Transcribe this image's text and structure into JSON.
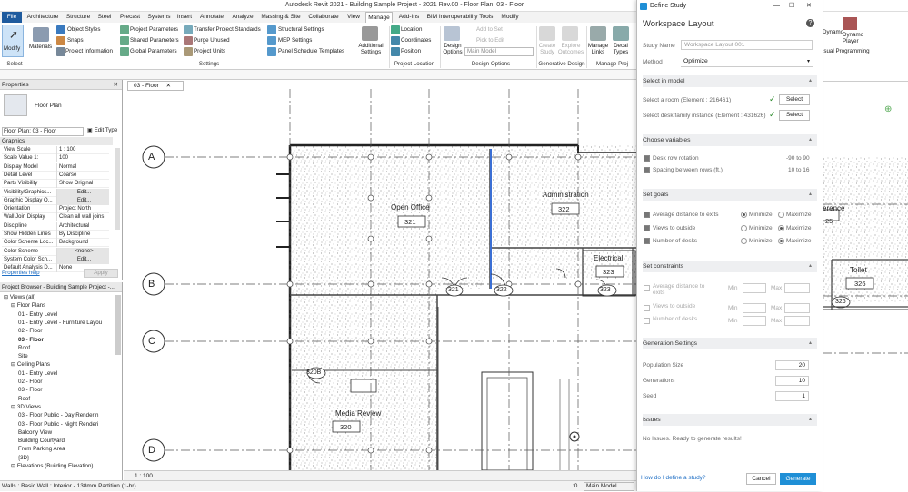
{
  "app": {
    "title": "Autodesk Revit 2021 - Building Sample Project - 2021 Rev.00 - Floor Plan: 03 - Floor"
  },
  "tabs": [
    "File",
    "Architecture",
    "Structure",
    "Steel",
    "Precast",
    "Systems",
    "Insert",
    "Annotate",
    "Analyze",
    "Massing & Site",
    "Collaborate",
    "View",
    "Manage",
    "Add-Ins",
    "BIM Interoperability Tools",
    "Modify"
  ],
  "ribbon": {
    "modify": "Modify",
    "materials": "Materials",
    "object_styles": "Object Styles",
    "snaps": "Snaps",
    "project_information": "Project Information",
    "project_parameters": "Project Parameters",
    "shared_parameters": "Shared Parameters",
    "global_parameters": "Global Parameters",
    "transfer_standards": "Transfer Project Standards",
    "purge_unused": "Purge Unused",
    "project_units": "Project Units",
    "structural_settings": "Structural Settings",
    "mep_settings": "MEP Settings",
    "panel_schedule_templates": "Panel Schedule Templates",
    "additional_settings": "Additional Settings",
    "location": "Location",
    "coordinates": "Coordinates",
    "position": "Position",
    "design_options": "Design Options",
    "add_to_set": "Add to Set",
    "pick_to_edit": "Pick to Edit",
    "main_model": "Main Model",
    "create_study": "Create Study",
    "explore_outcomes": "Explore Outcomes",
    "manage_links": "Manage Links",
    "decal_types": "Decal Types",
    "dynamo": "Dynamo",
    "dynamo_player": "Dynamo Player",
    "groups": {
      "select": "Select",
      "settings": "Settings",
      "project_location": "Project Location",
      "design_options": "Design Options",
      "generative_design": "Generative Design",
      "manage_project": "Manage Proj",
      "visual_programming": "isual Programming"
    }
  },
  "properties": {
    "title": "Properties",
    "type": "Floor Plan",
    "selector": "Floor Plan: 03 - Floor",
    "edit_type": "Edit Type",
    "section": "Graphics",
    "rows": [
      {
        "k": "View Scale",
        "v": "1 : 100"
      },
      {
        "k": "Scale Value 1:",
        "v": "100"
      },
      {
        "k": "Display Model",
        "v": "Normal"
      },
      {
        "k": "Detail Level",
        "v": "Coarse"
      },
      {
        "k": "Parts Visibility",
        "v": "Show Original"
      },
      {
        "k": "Visibility/Graphics...",
        "v": "Edit..."
      },
      {
        "k": "Graphic Display O...",
        "v": "Edit..."
      },
      {
        "k": "Orientation",
        "v": "Project North"
      },
      {
        "k": "Wall Join Display",
        "v": "Clean all wall joins"
      },
      {
        "k": "Discipline",
        "v": "Architectural"
      },
      {
        "k": "Show Hidden Lines",
        "v": "By Discipline"
      },
      {
        "k": "Color Scheme Loc...",
        "v": "Background"
      },
      {
        "k": "Color Scheme",
        "v": "<none>"
      },
      {
        "k": "System Color Sch...",
        "v": "Edit..."
      },
      {
        "k": "Default Analysis D...",
        "v": "None"
      }
    ],
    "help": "Properties help",
    "apply": "Apply"
  },
  "browser": {
    "title": "Project Browser - Building Sample Project -...",
    "items": [
      {
        "t": "Views (all)",
        "d": 0
      },
      {
        "t": "Floor Plans",
        "d": 1
      },
      {
        "t": "01 - Entry Level",
        "d": 2
      },
      {
        "t": "01 - Entry Level - Furniture Layou",
        "d": 2
      },
      {
        "t": "02 - Floor",
        "d": 2
      },
      {
        "t": "03 - Floor",
        "d": 2
      },
      {
        "t": "Roof",
        "d": 2
      },
      {
        "t": "Site",
        "d": 2
      },
      {
        "t": "Ceiling Plans",
        "d": 1
      },
      {
        "t": "01 - Entry Level",
        "d": 2
      },
      {
        "t": "02 - Floor",
        "d": 2
      },
      {
        "t": "03 - Floor",
        "d": 2
      },
      {
        "t": "Roof",
        "d": 2
      },
      {
        "t": "3D Views",
        "d": 1
      },
      {
        "t": "03 - Floor Public - Day Renderin",
        "d": 2
      },
      {
        "t": "03 - Floor Public - Night Renderi",
        "d": 2
      },
      {
        "t": "Balcony View",
        "d": 2
      },
      {
        "t": "Building Courtyard",
        "d": 2
      },
      {
        "t": "From Parking Area",
        "d": 2
      },
      {
        "t": "{3D}",
        "d": 2
      },
      {
        "t": "Elevations (Building Elevation)",
        "d": 1
      }
    ]
  },
  "view": {
    "tab": "03 - Floor",
    "grids": [
      "A",
      "B",
      "C",
      "D"
    ],
    "rooms": [
      {
        "name": "Open Office",
        "num": "321"
      },
      {
        "name": "Administration",
        "num": "322"
      },
      {
        "name": "Electrical",
        "num": "323"
      },
      {
        "name": "Media Review",
        "num": "320"
      },
      {
        "name": "Toilet",
        "num": "326"
      },
      {
        "name": "erence",
        "num": "25"
      }
    ],
    "tags": [
      "321",
      "322",
      "323",
      "320B",
      "326"
    ],
    "scale": "1 : 100"
  },
  "status": {
    "text": "Walls : Basic Wall : Interior - 138mm Partition (1-hr)",
    "model": "Main Model",
    "zero": ":0"
  },
  "dialog": {
    "window_title": "Define Study",
    "heading": "Workspace Layout",
    "study_name_label": "Study Name",
    "study_name_placeholder": "Workspace Layout 001",
    "method_label": "Method",
    "method_value": "Optimize",
    "sections": {
      "select": "Select in model",
      "variables": "Choose variables",
      "goals": "Set goals",
      "constraints": "Set constraints",
      "generation": "Generation Settings",
      "issues": "Issues"
    },
    "select_room": "Select a room (Element : 216461)",
    "select_desk": "Select desk family instance (Element : 431626)",
    "select_btn": "Select",
    "variables": [
      {
        "label": "Desk row rotation",
        "range": "-90 to 90"
      },
      {
        "label": "Spacing between rows (ft.)",
        "range": "10 to 16"
      }
    ],
    "goals": [
      {
        "label": "Average distance to exits",
        "choice": "Minimize"
      },
      {
        "label": "Views to outside",
        "choice": "Maximize"
      },
      {
        "label": "Number of desks",
        "choice": "Maximize"
      }
    ],
    "minimize": "Minimize",
    "maximize": "Maximize",
    "constraints": [
      {
        "label": "Average distance to exits"
      },
      {
        "label": "Views to outside"
      },
      {
        "label": "Number of desks"
      }
    ],
    "min": "Min",
    "max": "Max",
    "generation": [
      {
        "label": "Population Size",
        "value": "20"
      },
      {
        "label": "Generations",
        "value": "10"
      },
      {
        "label": "Seed",
        "value": "1"
      }
    ],
    "issues_text": "No Issues. Ready to generate results!",
    "help_link": "How do I define a study?",
    "cancel": "Cancel",
    "generate": "Generate",
    "accent": "#1f8fd6"
  }
}
